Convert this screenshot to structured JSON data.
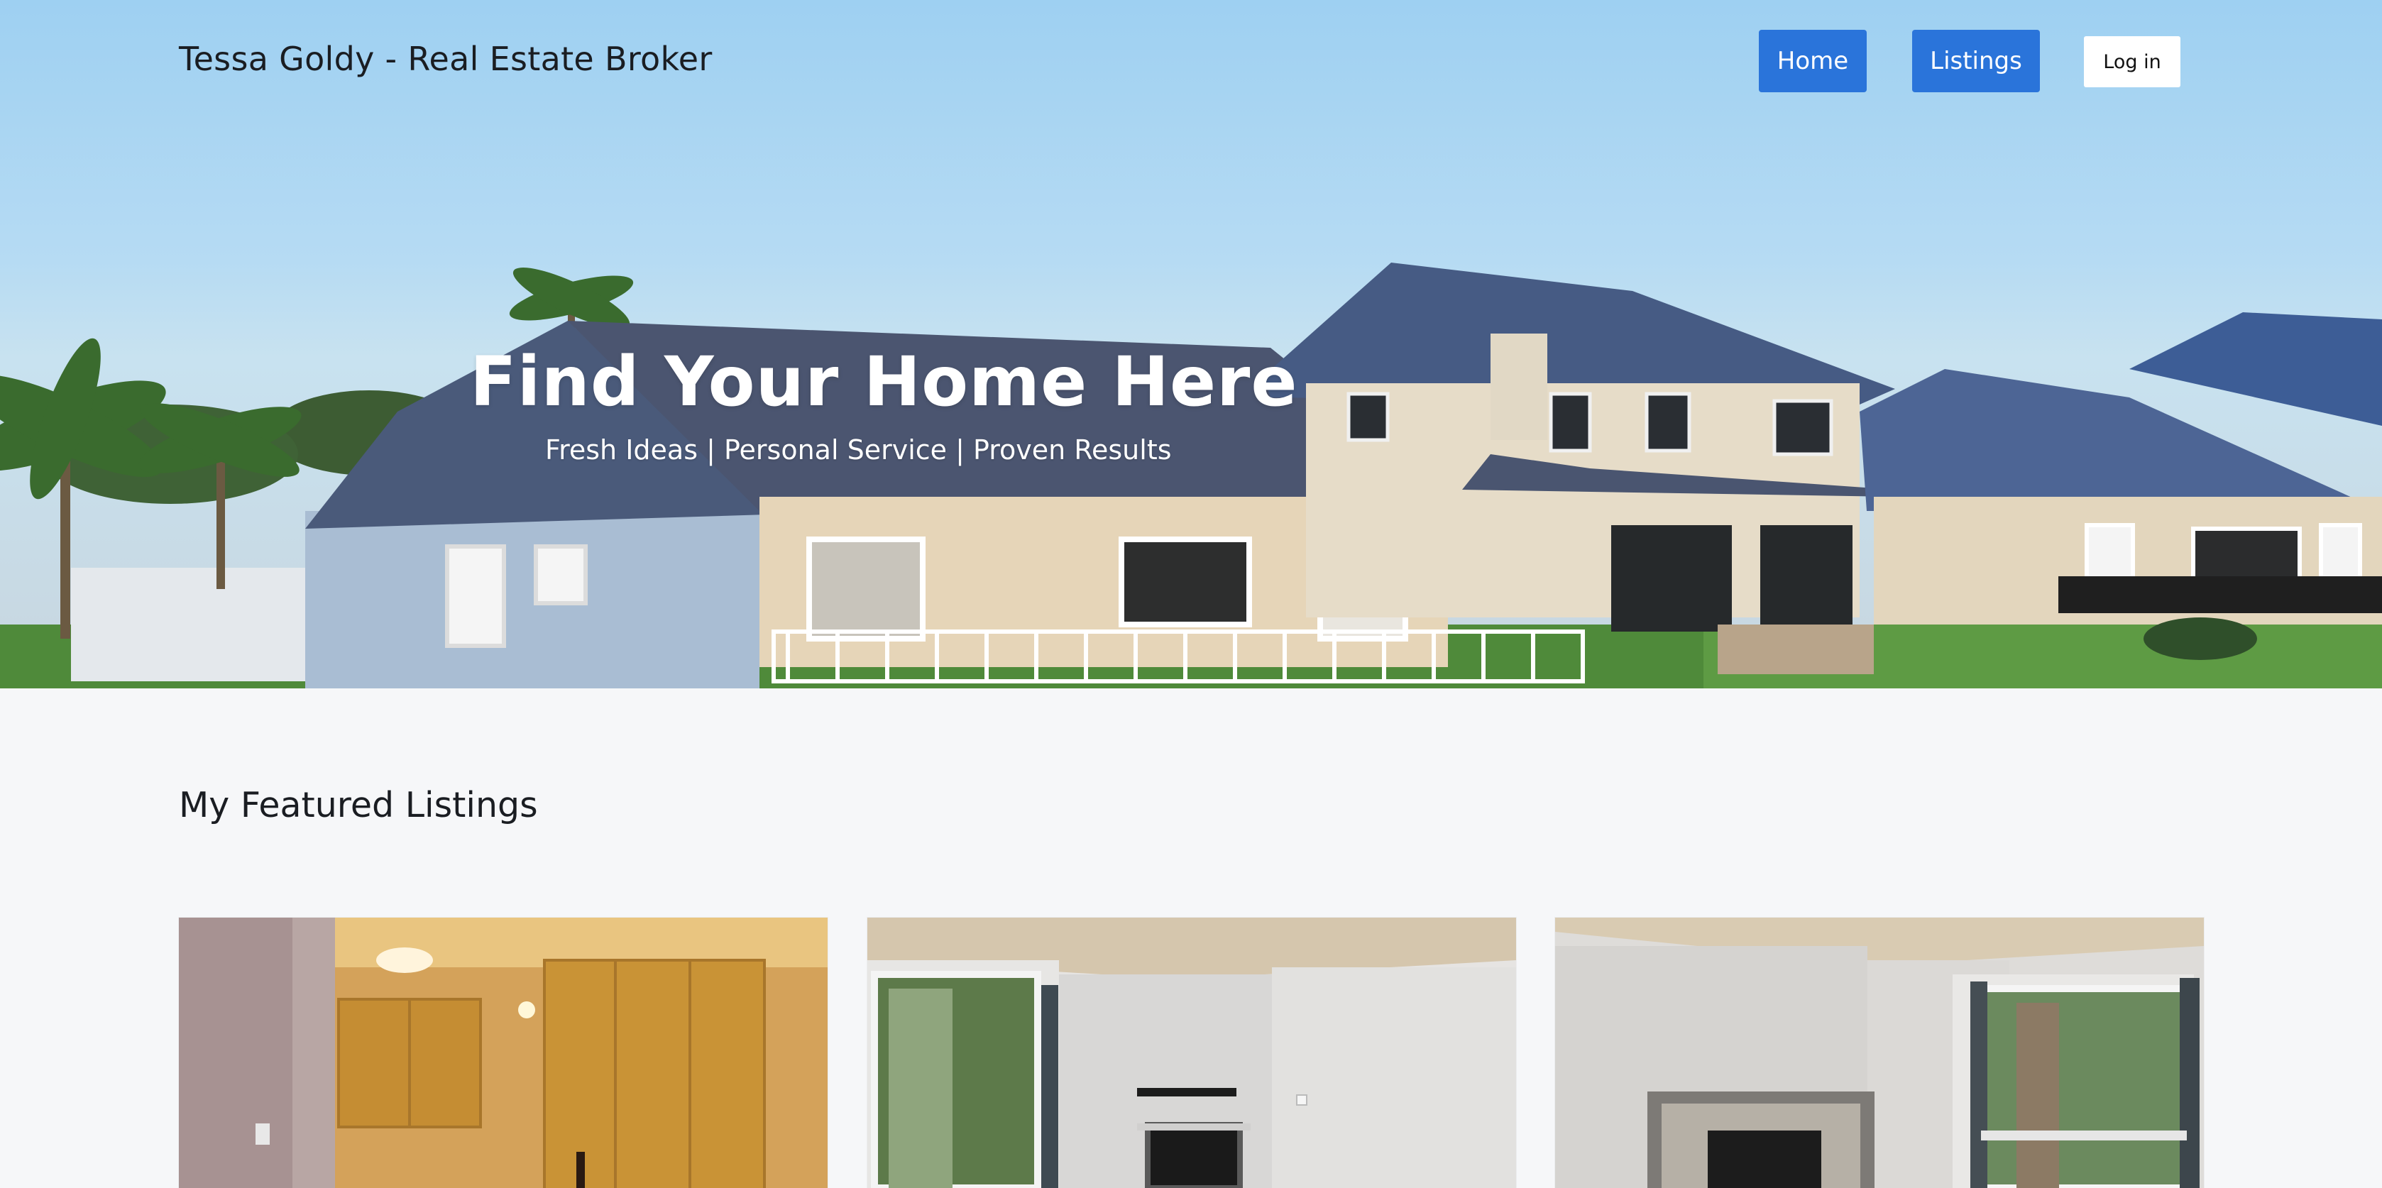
{
  "header": {
    "brand": "Tessa Goldy - Real Estate Broker",
    "nav": {
      "home": "Home",
      "listings": "Listings",
      "login": "Log in"
    }
  },
  "hero": {
    "title": "Find Your Home Here",
    "subtitle": "Fresh Ideas | Personal Service | Proven Results"
  },
  "featured": {
    "title": "My Featured Listings",
    "cards": [
      {
        "image": "kitchen-photo"
      },
      {
        "image": "living-room-fireplace-photo"
      },
      {
        "image": "living-room-fireplace-window-photo"
      }
    ]
  },
  "colors": {
    "primary_button": "#2a74da",
    "page_background": "#f6f7f9",
    "heading_text": "#1a1d22"
  }
}
